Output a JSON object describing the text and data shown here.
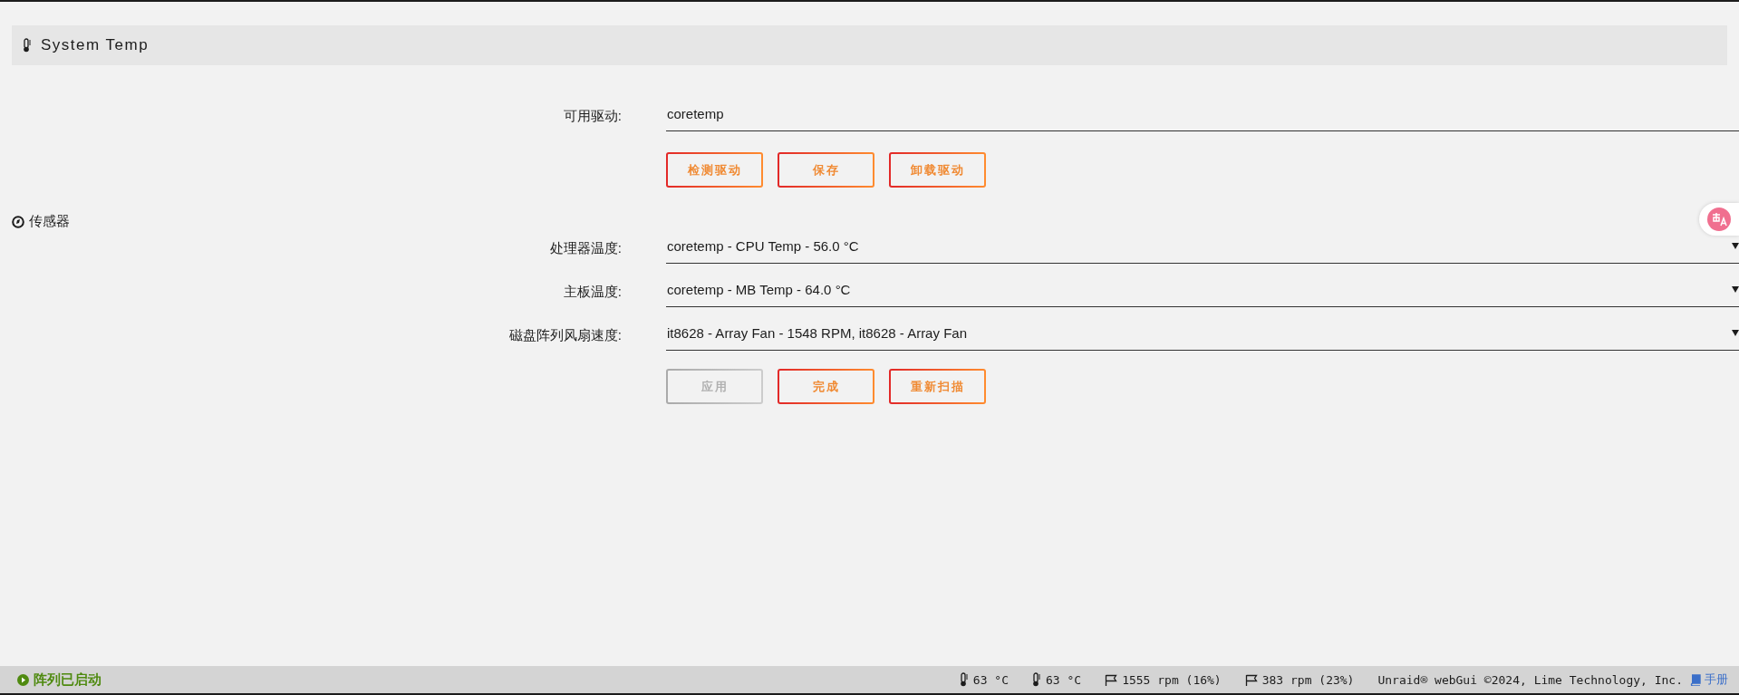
{
  "header": {
    "title": "System Temp"
  },
  "driver_section": {
    "label": "可用驱动:",
    "value": "coretemp",
    "buttons": [
      {
        "label": "检测驱动",
        "disabled": false
      },
      {
        "label": "保存",
        "disabled": false
      },
      {
        "label": "卸载驱动",
        "disabled": false
      }
    ]
  },
  "sensors_section": {
    "title": "传感器",
    "fields": [
      {
        "label": "处理器温度:",
        "value": "coretemp - CPU Temp - 56.0 °C"
      },
      {
        "label": "主板温度:",
        "value": "coretemp - MB Temp - 64.0 °C"
      },
      {
        "label": "磁盘阵列风扇速度:",
        "value": "it8628 - Array Fan - 1548 RPM, it8628 - Array Fan"
      }
    ],
    "buttons": [
      {
        "label": "应用",
        "disabled": true
      },
      {
        "label": "完成",
        "disabled": false
      },
      {
        "label": "重新扫描",
        "disabled": false
      }
    ]
  },
  "status_bar": {
    "array_status": "阵列已启动",
    "readings": [
      {
        "kind": "temp",
        "text": "63 °C"
      },
      {
        "kind": "temp",
        "text": "63 °C"
      },
      {
        "kind": "fan",
        "text": "1555 rpm (16%)"
      },
      {
        "kind": "fan",
        "text": "383 rpm (23%)"
      }
    ],
    "copyright": "Unraid® webGui ©2024, Lime Technology, Inc.",
    "manual_link": "手册"
  }
}
